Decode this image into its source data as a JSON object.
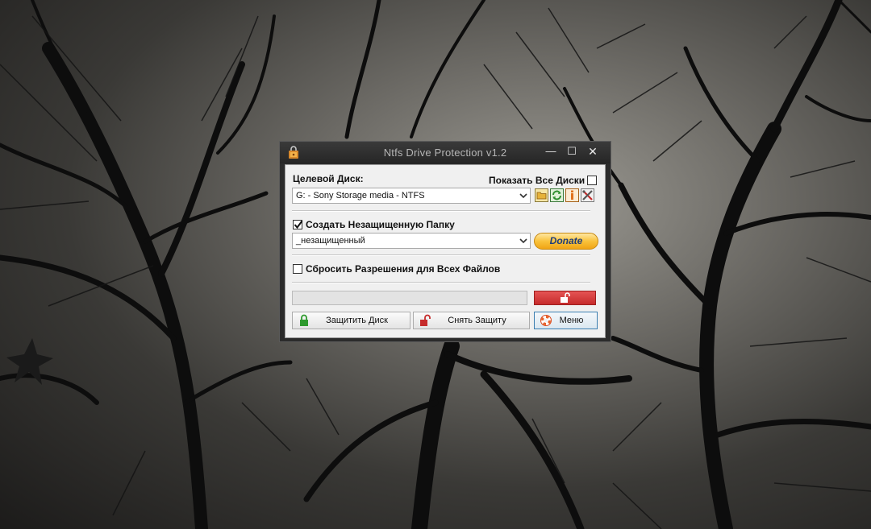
{
  "window": {
    "title": "Ntfs Drive Protection v1.2",
    "controls": {
      "minimize": "—",
      "maximize": "☐",
      "close": "✕"
    }
  },
  "target_disk": {
    "label": "Целевой Диск:",
    "selected": "G: - Sony Storage media - NTFS",
    "show_all_label": "Показать Все Диски",
    "show_all_checked": false,
    "icons": [
      "folder-icon",
      "refresh-icon",
      "info-icon",
      "tools-icon"
    ]
  },
  "unprotected_folder": {
    "checkbox_label": "Создать Незащищенную Папку",
    "checked": true,
    "folder_name": "_незащищенный",
    "donate_label": "Donate"
  },
  "reset_permissions": {
    "checkbox_label": "Сбросить Разрешения для Всех Файлов",
    "checked": false
  },
  "status": {
    "progress": 0,
    "lock_state_icon": "unlocked-padlock-icon"
  },
  "buttons": {
    "protect": "Защитить Диск",
    "unprotect": "Снять Защиту",
    "menu": "Меню"
  },
  "colors": {
    "window_frame": "#2b2b2b",
    "client_bg": "#f0f0f0",
    "unlock_red": "#d43c3c",
    "donate_orange": "#f7b526"
  }
}
